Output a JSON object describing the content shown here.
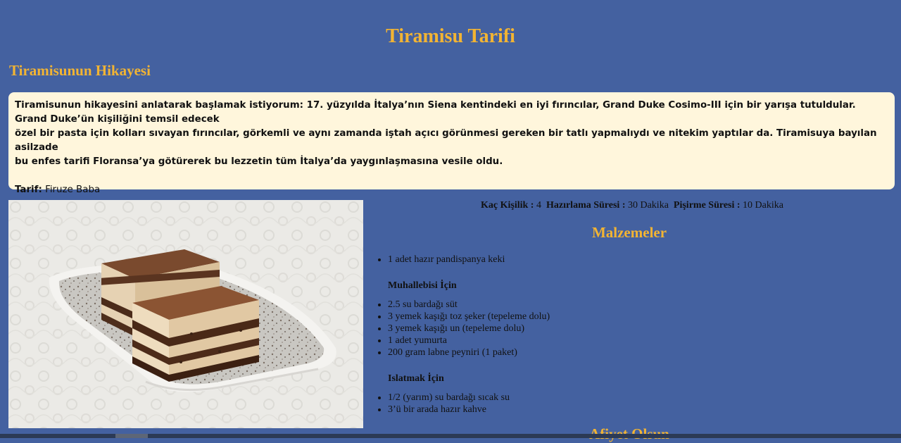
{
  "page": {
    "title": "Tiramisu Tarifi",
    "story_heading": "Tiramisunun Hikayesi",
    "story_lines": [
      "Tiramisunun hikayesini anlatarak başlamak istiyorum: 17. yüzyılda İtalya’nın Siena kentindeki en iyi fırıncılar, Grand Duke Cosimo-III için bir yarışa tutuldular. Grand Duke’ün kişiliğini temsil edecek",
      "özel bir pasta için kolları sıvayan fırıncılar, görkemli ve aynı zamanda iştah açıcı görünmesi gereken bir tatlı yapmalıydı ve nitekim yaptılar da. Tiramisuya bayılan asilzade",
      "bu enfes tarifi Floransa’ya götürerek bu lezzetin tüm İtalya’da yaygınlaşmasına vesile oldu."
    ],
    "tarif_label": "Tarif:",
    "tarif_value": "Firuze Baba",
    "closing": "Afiyet Olsun"
  },
  "info": {
    "kisilik_label": "Kaç Kişilik :",
    "kisilik_value": "4",
    "hazirlama_label": "Hazırlama Süresi :",
    "hazirlama_value": "30 Dakika",
    "pisirme_label": "Pişirme Süresi :",
    "pisirme_value": "10 Dakika"
  },
  "ingredients": {
    "heading": "Malzemeler",
    "base": [
      "1 adet hazır pandispanya keki"
    ],
    "muhallebi_heading": "Muhallebisi İçin",
    "muhallebi": [
      "2.5 su bardağı süt",
      "3 yemek kaşığı toz şeker (tepeleme dolu)",
      "3 yemek kaşığı un (tepeleme dolu)",
      "1 adet yumurta",
      "200 gram labne peyniri (1 paket)"
    ],
    "islatmak_heading": "Islatmak İçin",
    "islatmak": [
      "1/2 (yarım) su bardağı sıcak su",
      "3’ü bir arada hazır kahve"
    ]
  },
  "colors": {
    "background": "#4461a0",
    "accent": "#f2b433",
    "story_box": "#fff6dc"
  }
}
